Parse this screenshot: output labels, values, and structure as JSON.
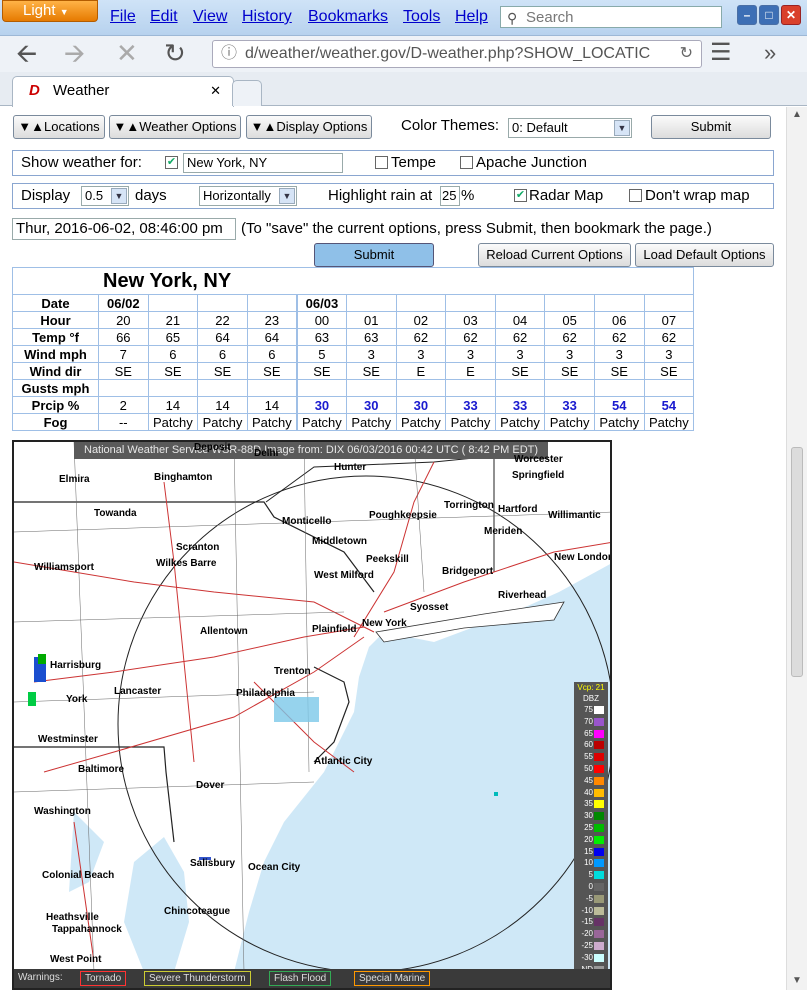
{
  "browser": {
    "menu_button": "Light",
    "menu": [
      "File",
      "Edit",
      "View",
      "History",
      "Bookmarks",
      "Tools",
      "Help"
    ],
    "search_placeholder": "Search",
    "url": "d/weather/weather.gov/D-weather.php?SHOW_LOCATIC",
    "tab_title": "Weather",
    "tab_logo": "D"
  },
  "options": {
    "locations_btn": "▼▲Locations",
    "weather_options_btn": "▼▲Weather Options",
    "display_options_btn": "▼▲Display Options",
    "color_themes_label": "Color Themes:",
    "color_theme_value": "0: Default",
    "submit": "Submit",
    "show_weather_label": "Show weather for:",
    "location_value": "New York, NY",
    "loc2": "Tempe",
    "loc3": "Apache Junction",
    "display_label": "Display",
    "days_value": "0.5",
    "days_label": "days",
    "orientation": "Horizontally",
    "highlight_label": "Highlight rain at",
    "highlight_value": "25",
    "percent": "%",
    "radar_label": "Radar Map",
    "nowrap_label": "Don't wrap map",
    "datetime": "Thur, 2016-06-02, 08:46:00 pm",
    "save_hint": "(To \"save\" the current options, press Submit, then bookmark the page.)",
    "submit2": "Submit",
    "reload_btn": "Reload Current Options",
    "default_btn": "Load Default Options"
  },
  "forecast": {
    "location": "New York, NY",
    "rows": [
      {
        "label": "Date",
        "cells": [
          "06/02",
          "",
          "",
          "",
          "06/03",
          "",
          "",
          "",
          "",
          "",
          "",
          ""
        ]
      },
      {
        "label": "Hour",
        "cells": [
          "20",
          "21",
          "22",
          "23",
          "00",
          "01",
          "02",
          "03",
          "04",
          "05",
          "06",
          "07"
        ]
      },
      {
        "label": "Temp °f",
        "cells": [
          "66",
          "65",
          "64",
          "64",
          "63",
          "63",
          "62",
          "62",
          "62",
          "62",
          "62",
          "62"
        ]
      },
      {
        "label": "Wind mph",
        "cells": [
          "7",
          "6",
          "6",
          "6",
          "5",
          "3",
          "3",
          "3",
          "3",
          "3",
          "3",
          "3"
        ]
      },
      {
        "label": "Wind dir",
        "cells": [
          "SE",
          "SE",
          "SE",
          "SE",
          "SE",
          "SE",
          "E",
          "E",
          "SE",
          "SE",
          "SE",
          "SE"
        ]
      },
      {
        "label": "Gusts mph",
        "cells": [
          "",
          "",
          "",
          "",
          "",
          "",
          "",
          "",
          "",
          "",
          "",
          ""
        ]
      },
      {
        "label": "Prcip %",
        "cells": [
          "2",
          "14",
          "14",
          "14",
          "30",
          "30",
          "30",
          "33",
          "33",
          "33",
          "54",
          "54"
        ]
      },
      {
        "label": "Fog",
        "cells": [
          "--",
          "Patchy",
          "Patchy",
          "Patchy",
          "Patchy",
          "Patchy",
          "Patchy",
          "Patchy",
          "Patchy",
          "Patchy",
          "Patchy",
          "Patchy"
        ]
      }
    ]
  },
  "radar": {
    "header": "National Weather Service WSR-88D Image from: DIX 06/03/2016 00:42 UTC ( 8:42 PM EDT)",
    "legend_title": "Vcp: 21",
    "legend_unit": "DBZ",
    "legend": [
      {
        "v": "75",
        "c": "#ffffff"
      },
      {
        "v": "70",
        "c": "#9955cc"
      },
      {
        "v": "65",
        "c": "#ff00ff"
      },
      {
        "v": "60",
        "c": "#bb0000"
      },
      {
        "v": "55",
        "c": "#dd0000"
      },
      {
        "v": "50",
        "c": "#ff0000"
      },
      {
        "v": "45",
        "c": "#ff8800"
      },
      {
        "v": "40",
        "c": "#ffbb00"
      },
      {
        "v": "35",
        "c": "#ffff00"
      },
      {
        "v": "30",
        "c": "#008800"
      },
      {
        "v": "25",
        "c": "#00bb00"
      },
      {
        "v": "20",
        "c": "#00ee00"
      },
      {
        "v": "15",
        "c": "#0000ee"
      },
      {
        "v": "10",
        "c": "#0099ff"
      },
      {
        "v": "5",
        "c": "#00dddd"
      },
      {
        "v": "0",
        "c": "#666666"
      },
      {
        "v": "-5",
        "c": "#999977"
      },
      {
        "v": "-10",
        "c": "#bbbb99"
      },
      {
        "v": "-15",
        "c": "#663366"
      },
      {
        "v": "-20",
        "c": "#996699"
      },
      {
        "v": "-25",
        "c": "#ccaacc"
      },
      {
        "v": "-30",
        "c": "#ccffff"
      },
      {
        "v": "ND",
        "c": "#999999"
      }
    ],
    "warnings_label": "Warnings:",
    "warnings": [
      {
        "name": "Tornado",
        "color": "#ff3333"
      },
      {
        "name": "Severe Thunderstorm",
        "color": "#cccc33"
      },
      {
        "name": "Flash Flood",
        "color": "#33aa55"
      },
      {
        "name": "Special Marine",
        "color": "#ff9900"
      }
    ],
    "cities": [
      "Hunter",
      "Worcester",
      "Elmira",
      "Binghamton",
      "Springfield",
      "Towanda",
      "Torrington",
      "Hartford",
      "Willimantic",
      "Monticello",
      "Poughkeepsie",
      "Middletown",
      "Meriden",
      "Scranton",
      "New London",
      "Williamsport",
      "Wilkes Barre",
      "Peekskill",
      "Bridgeport",
      "West Milford",
      "Riverhead",
      "Syosset",
      "New York",
      "Plainfield",
      "Allentown",
      "Harrisburg",
      "Trenton",
      "Lancaster",
      "Philadelphia",
      "York",
      "Westminster",
      "Atlantic City",
      "Baltimore",
      "Dover",
      "Washington",
      "Salisbury",
      "Ocean City",
      "Colonial Beach",
      "Chincoteague",
      "Heathsville",
      "Tappahannock",
      "West Point",
      "Deposit",
      "Delhi"
    ]
  }
}
